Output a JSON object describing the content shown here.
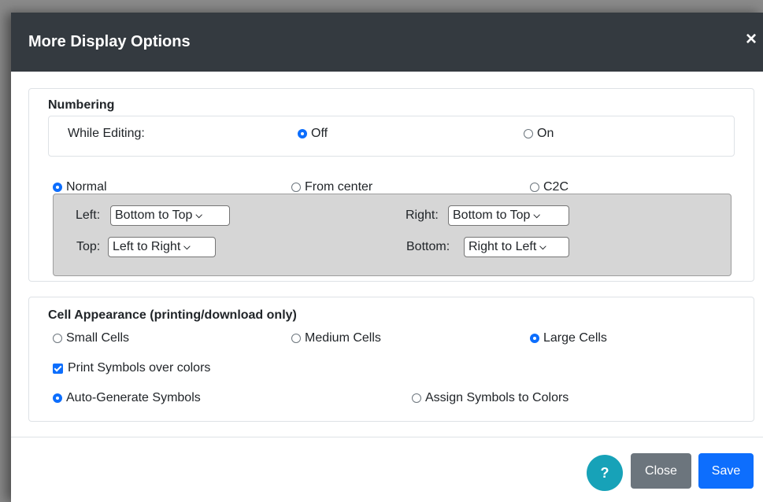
{
  "dialog": {
    "title": "More Display Options",
    "close_icon": "×"
  },
  "numbering": {
    "title": "Numbering",
    "while_editing": {
      "label": "While Editing:",
      "options": [
        {
          "label": "Off",
          "selected": true
        },
        {
          "label": "On",
          "selected": false
        }
      ]
    },
    "mode_options": [
      {
        "label": "Normal",
        "selected": true
      },
      {
        "label": "From center",
        "selected": false
      },
      {
        "label": "C2C",
        "selected": false
      }
    ],
    "directions": {
      "left": {
        "label": "Left:",
        "value": "Bottom to Top"
      },
      "right": {
        "label": "Right:",
        "value": "Bottom to Top"
      },
      "top": {
        "label": "Top:",
        "value": "Left to Right"
      },
      "bottom": {
        "label": "Bottom:",
        "value": "Right to Left"
      }
    }
  },
  "cell_appearance": {
    "title": "Cell Appearance (printing/download only)",
    "size_options": [
      {
        "label": "Small Cells",
        "selected": false
      },
      {
        "label": "Medium Cells",
        "selected": false
      },
      {
        "label": "Large Cells",
        "selected": true
      }
    ],
    "print_symbols": {
      "label": "Print Symbols over colors",
      "checked": true
    },
    "symbol_options": [
      {
        "label": "Auto-Generate Symbols",
        "selected": true
      },
      {
        "label": "Assign Symbols to Colors",
        "selected": false
      }
    ]
  },
  "footer": {
    "help_label": "?",
    "close_label": "Close",
    "save_label": "Save"
  },
  "colors": {
    "header_bg": "#343a40",
    "primary": "#0d6efd",
    "secondary": "#6c757d",
    "info": "#17a2b8"
  }
}
